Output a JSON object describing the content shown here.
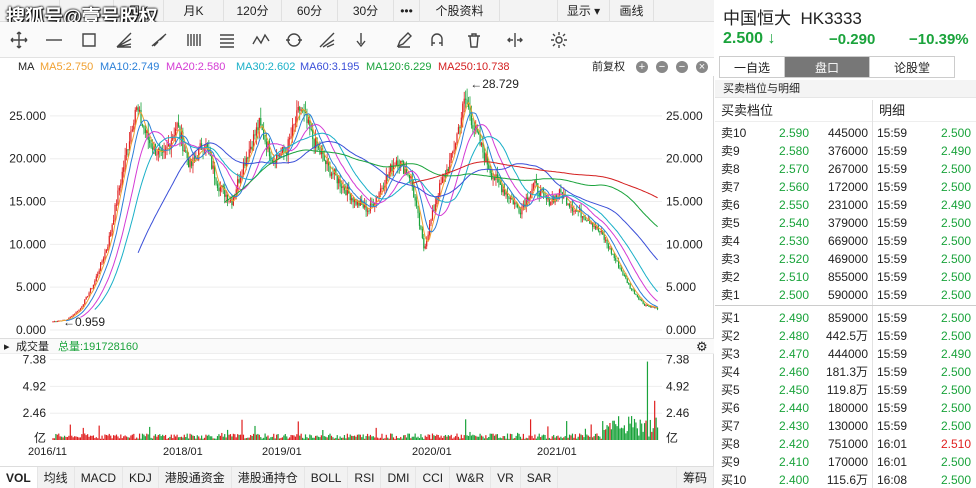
{
  "watermark": "搜狐号@壹号股权",
  "toolbar": {
    "tabs": [
      {
        "label": "",
        "w": 60
      },
      {
        "label": "",
        "w": 54
      },
      {
        "label": "周K",
        "w": 50
      },
      {
        "label": "月K",
        "w": 60
      },
      {
        "label": "120分",
        "w": 58
      },
      {
        "label": "60分",
        "w": 56
      },
      {
        "label": "30分",
        "w": 56
      },
      {
        "label": "•••",
        "w": 26
      },
      {
        "label": "个股资料",
        "w": 80
      },
      {
        "label": "",
        "w": 58
      },
      {
        "label": "显示 ▾",
        "w": 52
      },
      {
        "label": "画线",
        "w": 44
      }
    ]
  },
  "ma": {
    "label": "MA",
    "items": [
      {
        "text": "MA5:2.750",
        "color": "#f0a030"
      },
      {
        "text": "MA10:2.749",
        "color": "#2a7fd8"
      },
      {
        "text": "MA20:2.580",
        "color": "#d43bd4"
      },
      {
        "text": "MA30:2.602",
        "color": "#1ab0c8"
      },
      {
        "text": "MA60:3.195",
        "color": "#3a4fd8"
      },
      {
        "text": "MA120:6.229",
        "color": "#1aa33b"
      },
      {
        "text": "MA250:10.738",
        "color": "#d42020"
      }
    ],
    "restore_label": "前复权",
    "high_label": "←28.729",
    "low_label": "←0.959",
    "y_ticks": [
      "25.000",
      "20.000",
      "15.000",
      "10.000",
      "5.000",
      "0.000"
    ]
  },
  "volume": {
    "label": "成交量",
    "total_label": "总量:191728160",
    "y_ticks": [
      "7.38",
      "4.92",
      "2.46",
      "亿"
    ]
  },
  "x_axis": [
    "2016/11",
    "2018/01",
    "2019/01",
    "2020/01",
    "2021/01"
  ],
  "bottom_tabs": [
    "VOL",
    "均线",
    "MACD",
    "KDJ",
    "港股通资金",
    "港股通持仓",
    "BOLL",
    "RSI",
    "DMI",
    "CCI",
    "W&R",
    "VR",
    "SAR",
    "筹码"
  ],
  "quote": {
    "name": "中国恒大",
    "code": "HK3333",
    "price": "2.500 ↓",
    "change": "−0.290",
    "pct": "−10.39%",
    "tabs": [
      "一自选",
      "盘口",
      "论股堂"
    ],
    "sub_title": "买卖档位与明细",
    "book_title": "买卖档位",
    "detail_title": "明细",
    "asks": [
      {
        "label": "卖10",
        "price": "2.590",
        "vol": "445000"
      },
      {
        "label": "卖9",
        "price": "2.580",
        "vol": "376000"
      },
      {
        "label": "卖8",
        "price": "2.570",
        "vol": "267000"
      },
      {
        "label": "卖7",
        "price": "2.560",
        "vol": "172000"
      },
      {
        "label": "卖6",
        "price": "2.550",
        "vol": "231000"
      },
      {
        "label": "卖5",
        "price": "2.540",
        "vol": "379000"
      },
      {
        "label": "卖4",
        "price": "2.530",
        "vol": "669000"
      },
      {
        "label": "卖3",
        "price": "2.520",
        "vol": "469000"
      },
      {
        "label": "卖2",
        "price": "2.510",
        "vol": "855000"
      },
      {
        "label": "卖1",
        "price": "2.500",
        "vol": "590000"
      }
    ],
    "bids": [
      {
        "label": "买1",
        "price": "2.490",
        "vol": "859000"
      },
      {
        "label": "买2",
        "price": "2.480",
        "vol": "442.5万"
      },
      {
        "label": "买3",
        "price": "2.470",
        "vol": "444000"
      },
      {
        "label": "买4",
        "price": "2.460",
        "vol": "181.3万"
      },
      {
        "label": "买5",
        "price": "2.450",
        "vol": "119.8万"
      },
      {
        "label": "买6",
        "price": "2.440",
        "vol": "180000"
      },
      {
        "label": "买7",
        "price": "2.430",
        "vol": "130000"
      },
      {
        "label": "买8",
        "price": "2.420",
        "vol": "751000"
      },
      {
        "label": "买9",
        "price": "2.410",
        "vol": "170000"
      },
      {
        "label": "买10",
        "price": "2.400",
        "vol": "115.6万"
      }
    ],
    "trades_top": [
      {
        "time": "15:59",
        "price": "2.500",
        "up": false
      },
      {
        "time": "15:59",
        "price": "2.490",
        "up": false
      },
      {
        "time": "15:59",
        "price": "2.500",
        "up": false
      },
      {
        "time": "15:59",
        "price": "2.500",
        "up": false
      },
      {
        "time": "15:59",
        "price": "2.490",
        "up": false
      },
      {
        "time": "15:59",
        "price": "2.500",
        "up": false
      },
      {
        "time": "15:59",
        "price": "2.500",
        "up": false
      },
      {
        "time": "15:59",
        "price": "2.500",
        "up": false
      },
      {
        "time": "15:59",
        "price": "2.500",
        "up": false
      },
      {
        "time": "15:59",
        "price": "2.500",
        "up": false
      }
    ],
    "trades_bottom": [
      {
        "time": "15:59",
        "price": "2.500",
        "up": false
      },
      {
        "time": "15:59",
        "price": "2.500",
        "up": false
      },
      {
        "time": "15:59",
        "price": "2.490",
        "up": false
      },
      {
        "time": "15:59",
        "price": "2.500",
        "up": false
      },
      {
        "time": "15:59",
        "price": "2.500",
        "up": false
      },
      {
        "time": "15:59",
        "price": "2.500",
        "up": false
      },
      {
        "time": "15:59",
        "price": "2.500",
        "up": false
      },
      {
        "time": "16:01",
        "price": "2.510",
        "up": true
      },
      {
        "time": "16:01",
        "price": "2.500",
        "up": false
      },
      {
        "time": "16:08",
        "price": "2.500",
        "up": false
      }
    ]
  },
  "chart_data": {
    "type": "candlestick",
    "title": "中国恒大 HK3333",
    "x_ticks": [
      "2016/11",
      "2018/01",
      "2019/01",
      "2020/01",
      "2021/01"
    ],
    "ylim": [
      0,
      28.729
    ],
    "y_ticks": [
      0,
      5,
      10,
      15,
      20,
      25
    ],
    "high": 28.729,
    "low": 0.959,
    "approx_close_path": [
      1.0,
      1.2,
      2.5,
      5.5,
      10,
      18,
      26,
      22,
      20,
      24,
      19,
      22,
      17,
      15,
      20,
      24,
      20,
      21,
      26,
      22,
      19,
      17,
      15,
      14,
      17,
      20,
      18,
      9.5,
      16,
      20,
      27,
      22,
      18,
      16,
      14,
      17,
      15,
      16,
      14,
      13,
      11,
      8,
      5,
      3,
      2.5
    ],
    "ma_last": {
      "MA5": 2.75,
      "MA10": 2.749,
      "MA20": 2.58,
      "MA30": 2.602,
      "MA60": 3.195,
      "MA120": 6.229,
      "MA250": 10.738
    },
    "volume_y_ticks": [
      2.46,
      4.92,
      7.38
    ],
    "volume_unit": "亿",
    "total_volume": 191728160
  }
}
